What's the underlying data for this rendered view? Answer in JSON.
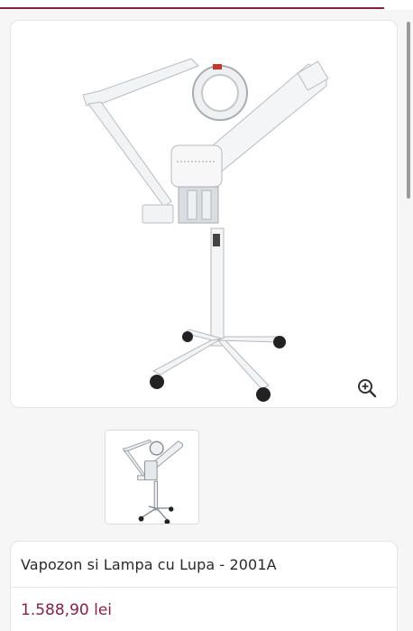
{
  "theme": {
    "accent": "#8a1f45"
  },
  "gallery": {
    "main_image_alt": "product-photo",
    "zoom_icon": "zoom-in-icon",
    "thumbnails": [
      "product-thumbnail"
    ]
  },
  "product": {
    "title": "Vapozon si Lampa cu Lupa - 2001A",
    "price": "1.588,90 lei"
  }
}
